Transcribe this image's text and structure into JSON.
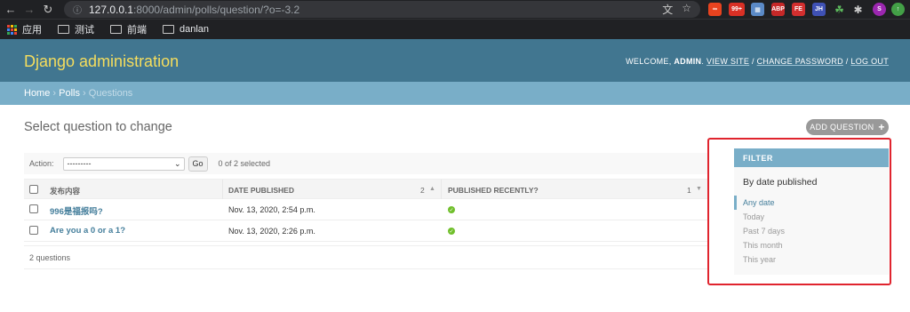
{
  "browser": {
    "url_host": "127.0.0.1",
    "url_path": ":8000/admin/polls/question/?o=-3.2",
    "bookmarks": [
      "应用",
      "测试",
      "前端",
      "danlan"
    ],
    "ext_badge": "99+",
    "extensions": [
      "ABP",
      "FE",
      "JH",
      "S"
    ]
  },
  "header": {
    "branding": "Django administration",
    "welcome": "WELCOME,",
    "username": "ADMIN",
    "view_site": "VIEW SITE",
    "change_password": "CHANGE PASSWORD",
    "log_out": "LOG OUT",
    "sep": "/"
  },
  "breadcrumbs": {
    "home": "Home",
    "app": "Polls",
    "current": "Questions",
    "sep": "›"
  },
  "content": {
    "title": "Select question to change",
    "add_button": "ADD QUESTION",
    "action_label": "Action:",
    "action_selected": "---------",
    "go_label": "Go",
    "counter": "0 of 2 selected",
    "columns": {
      "question": "发布内容",
      "date": "DATE PUBLISHED",
      "date_sort_priority": "2",
      "recent": "PUBLISHED RECENTLY?",
      "recent_sort_priority": "1"
    },
    "rows": [
      {
        "question": "996是福报吗?",
        "date": "Nov. 13, 2020, 2:54 p.m.",
        "recent": true
      },
      {
        "question": "Are you a 0 or a 1?",
        "date": "Nov. 13, 2020, 2:26 p.m.",
        "recent": true
      }
    ],
    "paginator": "2 questions"
  },
  "filter": {
    "title": "FILTER",
    "subtitle": "By date published",
    "options": [
      "Any date",
      "Today",
      "Past 7 days",
      "This month",
      "This year"
    ],
    "selected": "Any date"
  },
  "colors": {
    "header_bg": "#417690",
    "branding": "#f5dd5d",
    "breadcrumbs_bg": "#79aec8",
    "link": "#447e9b",
    "highlight": "#e0242e"
  }
}
